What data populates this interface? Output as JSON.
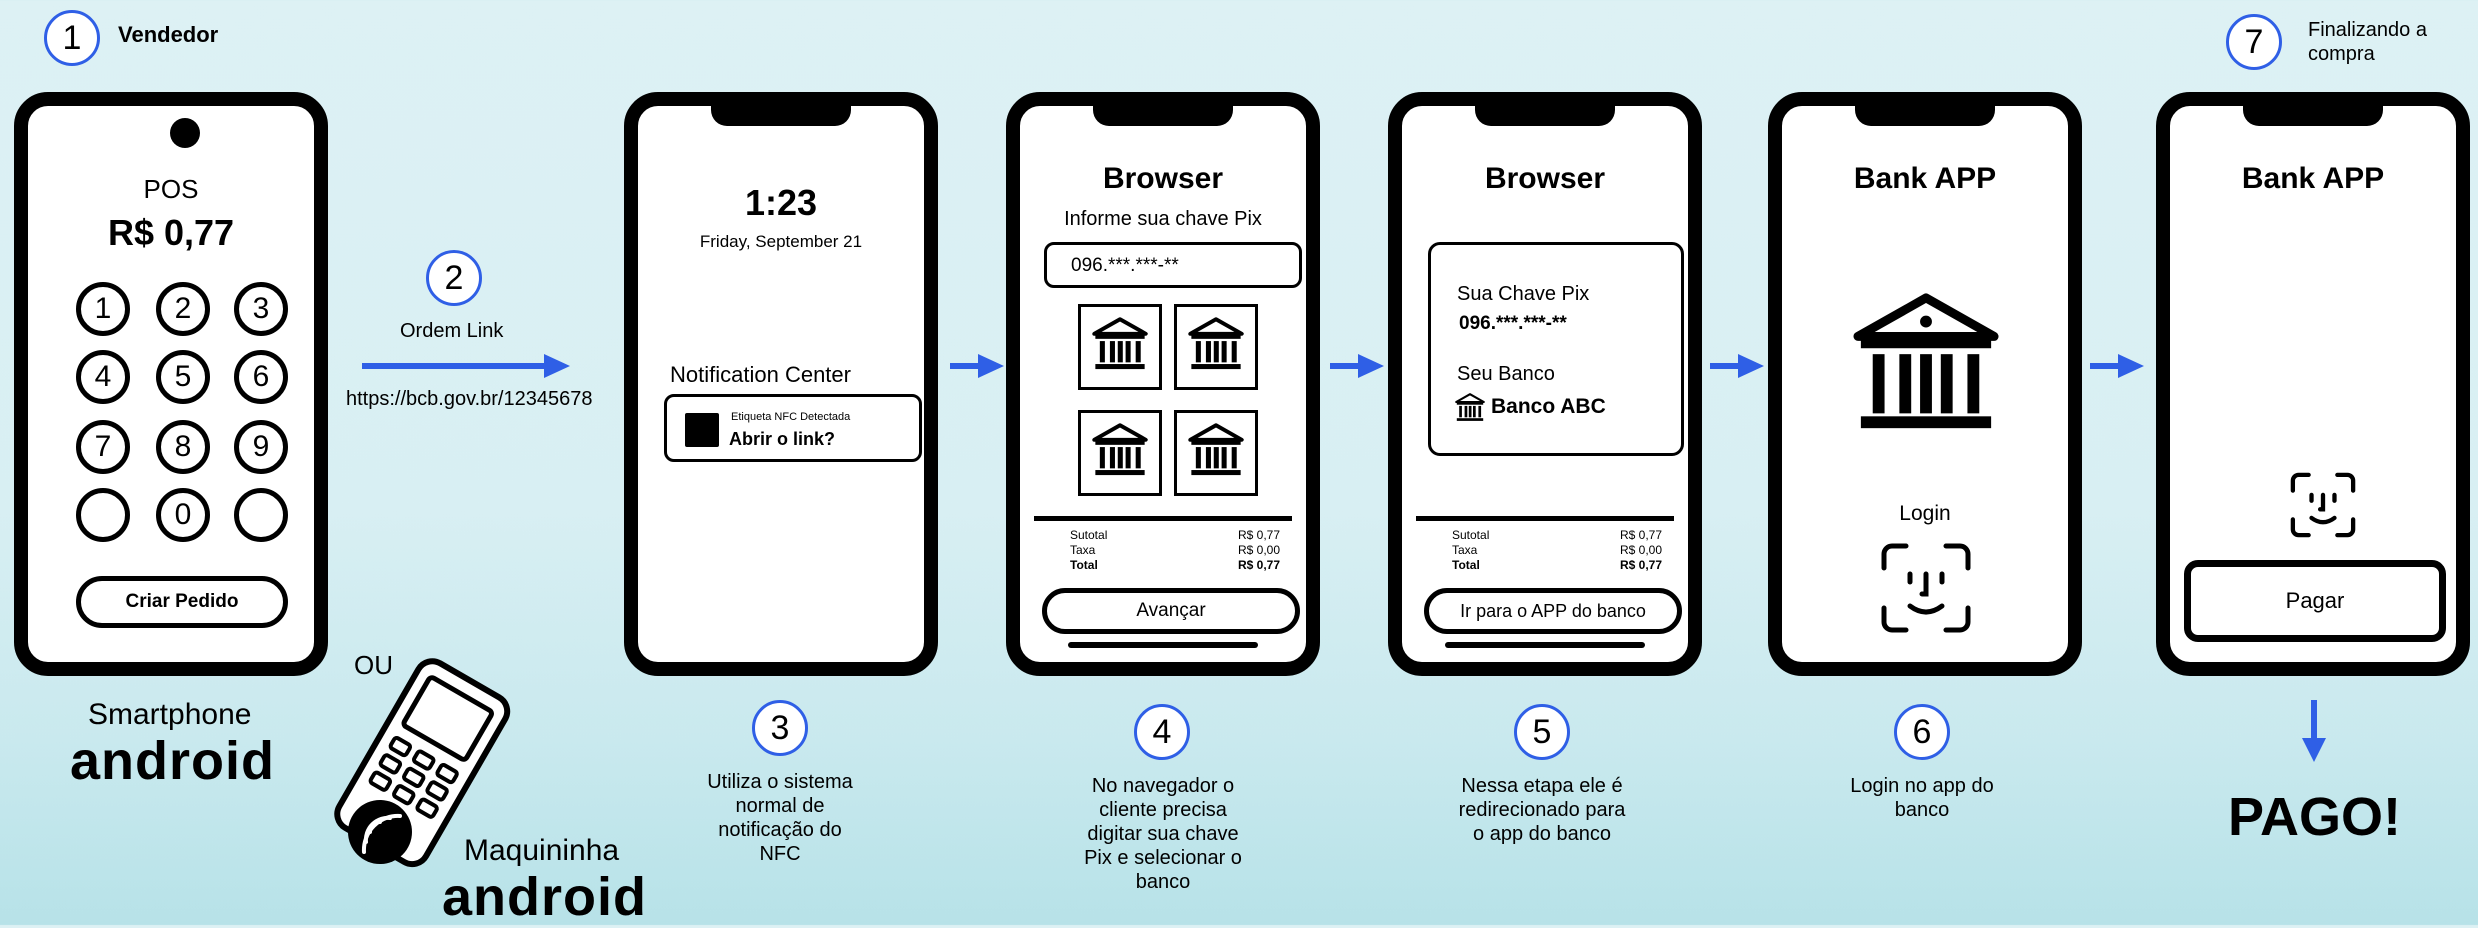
{
  "step1": {
    "num": "1",
    "title": "Vendedor"
  },
  "pos": {
    "label": "POS",
    "amount": "R$ 0,77",
    "keys": [
      "1",
      "2",
      "3",
      "4",
      "5",
      "6",
      "7",
      "8",
      "9",
      "",
      "0",
      ""
    ],
    "button": "Criar Pedido"
  },
  "device_labels": {
    "smartphone": "Smartphone",
    "android1": "android",
    "ou": "OU",
    "maquininha": "Maquininha",
    "android2": "android"
  },
  "step2": {
    "num": "2",
    "label": "Ordem Link",
    "url": "https://bcb.gov.br/12345678"
  },
  "phone2": {
    "time": "1:23",
    "date": "Friday, September 21",
    "nc_title": "Notification Center",
    "nfc_small": "Etiqueta NFC Detectada",
    "nfc_big": "Abrir o link?"
  },
  "step3": {
    "num": "3",
    "caption": [
      "Utiliza o sistema",
      "normal de",
      "notificação do",
      "NFC"
    ]
  },
  "phone3": {
    "title": "Browser",
    "prompt": "Informe sua chave Pix",
    "pix_value": "096.***.***-**",
    "button": "Avançar"
  },
  "totals": {
    "subtotal_label": "Sutotal",
    "subtotal": "R$ 0,77",
    "taxa_label": "Taxa",
    "taxa": "R$ 0,00",
    "total_label": "Total",
    "total": "R$ 0,77"
  },
  "step4": {
    "num": "4",
    "caption": [
      "No navegador o",
      "cliente precisa",
      "digitar sua chave",
      "Pix e selecionar o",
      "banco"
    ]
  },
  "phone4": {
    "title": "Browser",
    "chave_label": "Sua Chave Pix",
    "chave_value": "096.***.***-**",
    "banco_label": "Seu Banco",
    "banco_value": "Banco ABC",
    "button": "Ir para o APP do banco"
  },
  "step5": {
    "num": "5",
    "caption": [
      "Nessa etapa ele é",
      "redirecionado para",
      "o app do banco"
    ]
  },
  "phone5": {
    "title": "Bank APP",
    "login": "Login"
  },
  "step6": {
    "num": "6",
    "caption": [
      "Login no app do",
      "banco"
    ]
  },
  "phone6": {
    "title": "Bank APP",
    "button": "Pagar"
  },
  "step7": {
    "num": "7",
    "label": [
      "Finalizando a",
      "compra"
    ]
  },
  "final": {
    "text": "PAGO!"
  },
  "colors": {
    "accent": "#2f5fe6",
    "ink": "#000000"
  },
  "icons": [
    "bank-icon",
    "face-id-icon",
    "nfc-icon"
  ]
}
